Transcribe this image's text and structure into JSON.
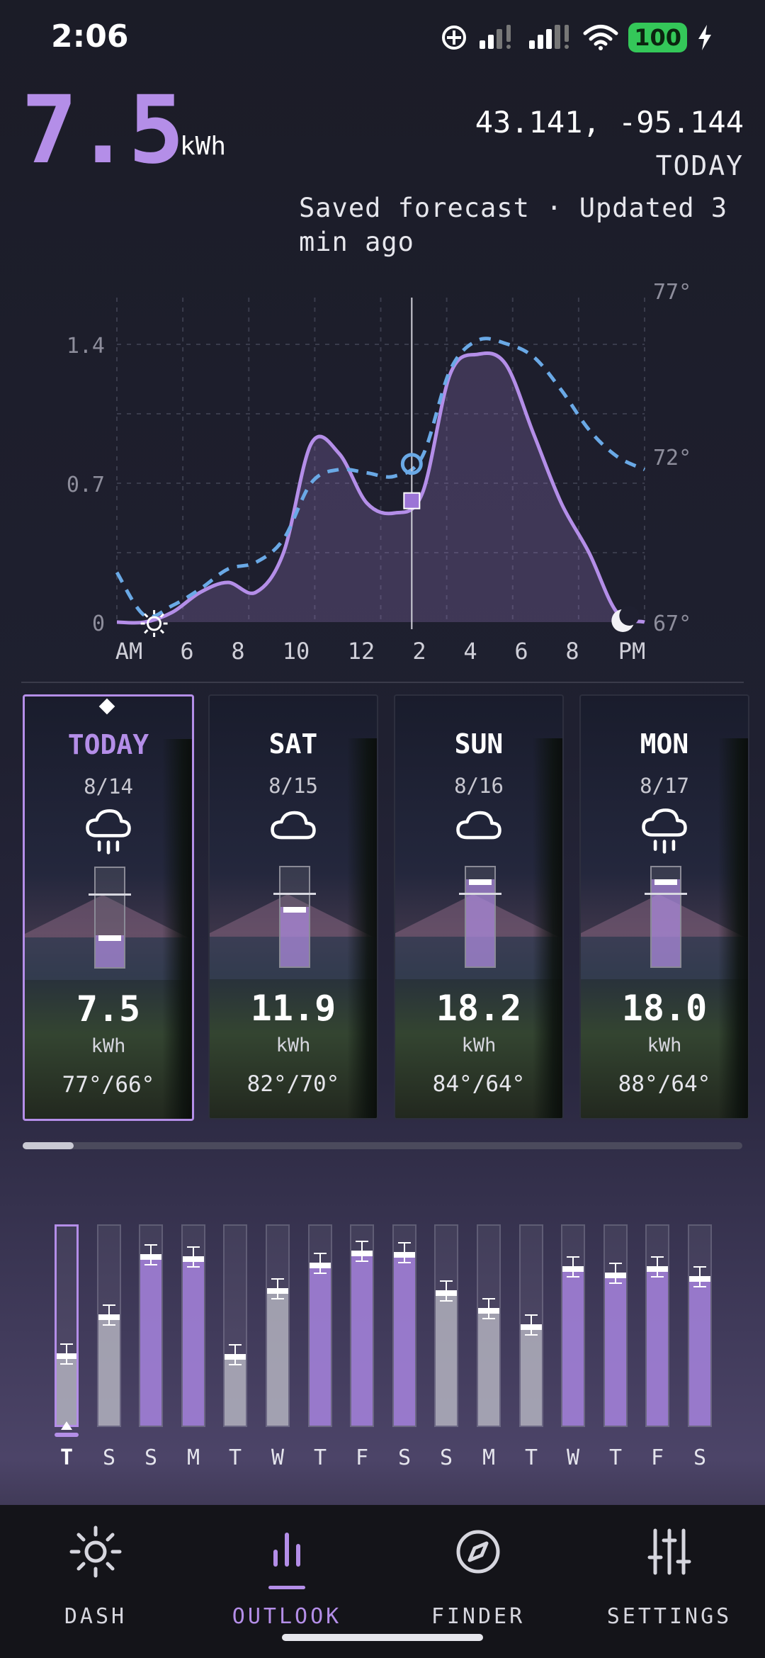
{
  "status": {
    "time": "2:06",
    "battery": "100"
  },
  "header": {
    "kwh_value": "7.5",
    "kwh_unit": "kWh",
    "coords": "43.141, -95.144",
    "day_label": "TODAY",
    "saved_note": "Saved forecast · Updated 3 min ago"
  },
  "chart_data": {
    "type": "line",
    "x_ticks": [
      "AM",
      "6",
      "8",
      "10",
      "12",
      "2",
      "4",
      "6",
      "8",
      "PM"
    ],
    "x": [
      4,
      5,
      6,
      7,
      8,
      9,
      10,
      11,
      12,
      12.5,
      13,
      14,
      15,
      16,
      17,
      18,
      19,
      20,
      21
    ],
    "series": [
      {
        "values": [
          0,
          0,
          0.05,
          0.15,
          0.2,
          0.15,
          0.35,
          0.9,
          0.85,
          0.6,
          0.55,
          0.65,
          1.25,
          1.35,
          1.3,
          0.95,
          0.6,
          0.35,
          0.05,
          0
        ]
      },
      {
        "values": [
          68.5,
          67.2,
          67.5,
          68,
          68.6,
          68.8,
          69.5,
          71.2,
          71.6,
          71.5,
          71.4,
          72,
          74.6,
          75.5,
          75.4,
          75,
          74,
          72.8,
          72,
          71.6
        ]
      }
    ],
    "y_left_ticks": [
      "0",
      "0.7",
      "1.4"
    ],
    "y_right_ticks": [
      "67°",
      "72°",
      "77°"
    ],
    "ylim_left": [
      0,
      1.6
    ],
    "ylim_right": [
      67,
      77
    ],
    "now_marker_x": 13.5,
    "grid": true
  },
  "days": [
    {
      "name": "TODAY",
      "date": "8/14",
      "icon": "rain-cloud-icon",
      "value": "7.5",
      "unit": "kWh",
      "temps": "77°/66°",
      "fill": 0.32,
      "avg": 0.72,
      "selected": true
    },
    {
      "name": "SAT",
      "date": "8/15",
      "icon": "cloud-icon",
      "value": "11.9",
      "unit": "kWh",
      "temps": "82°/70°",
      "fill": 0.6,
      "avg": 0.72,
      "selected": false
    },
    {
      "name": "SUN",
      "date": "8/16",
      "icon": "cloud-icon",
      "value": "18.2",
      "unit": "kWh",
      "temps": "84°/64°",
      "fill": 0.88,
      "avg": 0.72,
      "selected": false
    },
    {
      "name": "MON",
      "date": "8/17",
      "icon": "rain-cloud-icon",
      "value": "18.0",
      "unit": "kWh",
      "temps": "88°/64°",
      "fill": 0.88,
      "avg": 0.72,
      "selected": false
    }
  ],
  "bars": [
    {
      "label": "T",
      "value": 0.35,
      "purple": false,
      "selected": true
    },
    {
      "label": "S",
      "value": 0.55,
      "purple": false
    },
    {
      "label": "S",
      "value": 0.85,
      "purple": true
    },
    {
      "label": "M",
      "value": 0.84,
      "purple": true
    },
    {
      "label": "T",
      "value": 0.35,
      "purple": false
    },
    {
      "label": "W",
      "value": 0.68,
      "purple": false
    },
    {
      "label": "T",
      "value": 0.81,
      "purple": true
    },
    {
      "label": "F",
      "value": 0.87,
      "purple": true
    },
    {
      "label": "S",
      "value": 0.86,
      "purple": true
    },
    {
      "label": "S",
      "value": 0.67,
      "purple": false
    },
    {
      "label": "M",
      "value": 0.58,
      "purple": false
    },
    {
      "label": "T",
      "value": 0.5,
      "purple": false
    },
    {
      "label": "W",
      "value": 0.79,
      "purple": true
    },
    {
      "label": "T",
      "value": 0.76,
      "purple": true
    },
    {
      "label": "F",
      "value": 0.79,
      "purple": true
    },
    {
      "label": "S",
      "value": 0.74,
      "purple": true
    }
  ],
  "nav": [
    {
      "label": "DASH",
      "icon": "sun-icon"
    },
    {
      "label": "OUTLOOK",
      "icon": "bar-chart-icon",
      "active": true
    },
    {
      "label": "FINDER",
      "icon": "compass-icon"
    },
    {
      "label": "SETTINGS",
      "icon": "sliders-icon"
    }
  ],
  "colors": {
    "accent": "#b48ee8",
    "forecast_line": "#6aa9e6",
    "battery": "#34c759"
  }
}
